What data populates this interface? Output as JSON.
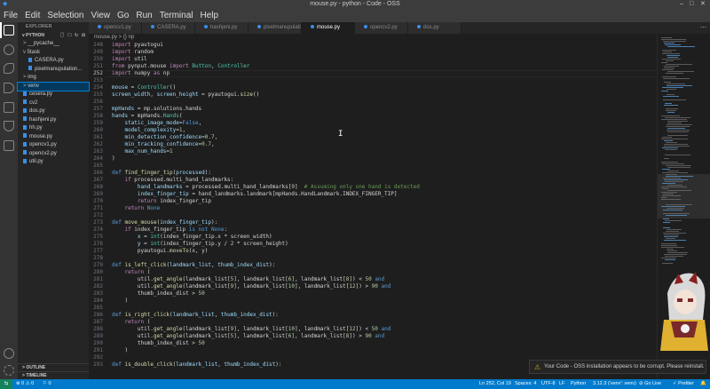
{
  "window": {
    "title": "mouse.py - python - Code - OSS",
    "controls": [
      "–",
      "□",
      "✕"
    ]
  },
  "menu": [
    "File",
    "Edit",
    "Selection",
    "View",
    "Go",
    "Run",
    "Terminal",
    "Help"
  ],
  "sidebar": {
    "title": "EXPLORER",
    "folder": "PYTHON",
    "items": [
      {
        "label": "__pycache__",
        "prefix": ">",
        "indent": 1
      },
      {
        "label": "5task",
        "prefix": "v",
        "indent": 1
      },
      {
        "label": "CASERA.py",
        "indent": 2
      },
      {
        "label": "pixelmanupulation...",
        "indent": 2
      },
      {
        "label": "img",
        "prefix": ">",
        "indent": 1
      },
      {
        "label": "venv",
        "prefix": ">",
        "indent": 1,
        "selected": true
      },
      {
        "label": "cesera.py",
        "indent": 1
      },
      {
        "label": "cv2",
        "indent": 1
      },
      {
        "label": "dos.py",
        "indent": 1
      },
      {
        "label": "hashjeni.py",
        "indent": 1
      },
      {
        "label": "hh.py",
        "indent": 1
      },
      {
        "label": "mouse.py",
        "indent": 1
      },
      {
        "label": "opencv1.py",
        "indent": 1
      },
      {
        "label": "opencv2.py",
        "indent": 1
      },
      {
        "label": "util.py",
        "indent": 1
      }
    ],
    "outline": "OUTLINE",
    "timeline": "TIMELINE"
  },
  "tabs": [
    {
      "label": "opencv1.py"
    },
    {
      "label": "CASERA.py"
    },
    {
      "label": "hashjeni.py"
    },
    {
      "label": "pixelmanupulation.py"
    },
    {
      "label": "mouse.py",
      "active": true
    },
    {
      "label": "opencv2.py"
    },
    {
      "label": "dos.py"
    }
  ],
  "breadcrumb": "mouse.py > {} np",
  "editor": {
    "current_line": 252,
    "lines": [
      {
        "n": 248,
        "html": "<span class=\"kw2\">import</span> pyautogui"
      },
      {
        "n": 249,
        "html": "<span class=\"kw2\">import</span> random"
      },
      {
        "n": 250,
        "html": "<span class=\"kw2\">import</span> util"
      },
      {
        "n": 251,
        "html": "<span class=\"kw2\">from</span> pynput.mouse <span class=\"kw2\">import</span> <span class=\"cls\">Button</span>, <span class=\"cls\">Controller</span>"
      },
      {
        "n": 252,
        "html": "<span class=\"kw2\">import</span> numpy <span class=\"kw2\">as</span> np"
      },
      {
        "n": 253,
        "html": ""
      },
      {
        "n": 254,
        "html": "<span class=\"vr\">mouse</span> = <span class=\"cls\">Controller</span>()"
      },
      {
        "n": 255,
        "html": "<span class=\"vr\">screen_width</span>, <span class=\"vr\">screen_height</span> = pyautogui.<span class=\"fn\">size</span>()"
      },
      {
        "n": 256,
        "html": ""
      },
      {
        "n": 257,
        "html": "<span class=\"vr\">mpHands</span> = mp.solutions.hands"
      },
      {
        "n": 258,
        "html": "<span class=\"vr\">hands</span> = mpHands.<span class=\"cls\">Hands</span>("
      },
      {
        "n": 259,
        "html": "    <span class=\"vr\">static_image_mode</span>=<span class=\"kw\">False</span>,"
      },
      {
        "n": 260,
        "html": "    <span class=\"vr\">model_complexity</span>=<span class=\"num\">1</span>,"
      },
      {
        "n": 261,
        "html": "    <span class=\"vr\">min_detection_confidence</span>=<span class=\"num\">0.7</span>,"
      },
      {
        "n": 262,
        "html": "    <span class=\"vr\">min_tracking_confidence</span>=<span class=\"num\">0.7</span>,"
      },
      {
        "n": 263,
        "html": "    <span class=\"vr\">max_num_hands</span>=<span class=\"num\">1</span>"
      },
      {
        "n": 264,
        "html": ")"
      },
      {
        "n": 265,
        "html": ""
      },
      {
        "n": 266,
        "html": "<span class=\"kw\">def</span> <span class=\"fn\">find_finger_tip</span>(<span class=\"vr\">processed</span>):"
      },
      {
        "n": 267,
        "html": "    <span class=\"kw2\">if</span> processed.multi_hand_landmarks:"
      },
      {
        "n": 268,
        "html": "        <span class=\"vr\">hand_landmarks</span> = processed.multi_hand_landmarks[<span class=\"num\">0</span>]  <span class=\"cm\"># Assuming only one hand is detected</span>"
      },
      {
        "n": 269,
        "html": "        <span class=\"vr\">index_finger_tip</span> = hand_landmarks.landmark[mpHands.HandLandmark.INDEX_FINGER_TIP]"
      },
      {
        "n": 270,
        "html": "        <span class=\"kw2\">return</span> index_finger_tip"
      },
      {
        "n": 271,
        "html": "    <span class=\"kw2\">return</span> <span class=\"kw\">None</span>"
      },
      {
        "n": 272,
        "html": ""
      },
      {
        "n": 273,
        "html": "<span class=\"kw\">def</span> <span class=\"fn\">move_mouse</span>(<span class=\"vr\">index_finger_tip</span>):"
      },
      {
        "n": 274,
        "html": "    <span class=\"kw2\">if</span> index_finger_tip <span class=\"kw\">is not</span> <span class=\"kw\">None</span>:"
      },
      {
        "n": 275,
        "html": "        <span class=\"vr\">x</span> = <span class=\"cls\">int</span>(index_finger_tip.x * screen_width)"
      },
      {
        "n": 276,
        "html": "        <span class=\"vr\">y</span> = <span class=\"cls\">int</span>(index_finger_tip.y / <span class=\"num\">2</span> * screen_height)"
      },
      {
        "n": 277,
        "html": "        pyautogui.<span class=\"fn\">moveTo</span>(x, y)"
      },
      {
        "n": 278,
        "html": ""
      },
      {
        "n": 279,
        "html": "<span class=\"kw\">def</span> <span class=\"fn\">is_left_click</span>(<span class=\"vr\">landmark_list</span>, <span class=\"vr\">thumb_index_dist</span>):"
      },
      {
        "n": 280,
        "html": "    <span class=\"kw2\">return</span> ("
      },
      {
        "n": 281,
        "html": "        util.<span class=\"fn\">get_angle</span>(landmark_list[<span class=\"num\">5</span>], landmark_list[<span class=\"num\">6</span>], landmark_list[<span class=\"num\">8</span>]) &lt; <span class=\"num\">50</span> <span class=\"kw\">and</span>"
      },
      {
        "n": 282,
        "html": "        util.<span class=\"fn\">get_angle</span>(landmark_list[<span class=\"num\">9</span>], landmark_list[<span class=\"num\">10</span>], landmark_list[<span class=\"num\">12</span>]) &gt; <span class=\"num\">90</span> <span class=\"kw\">and</span>"
      },
      {
        "n": 283,
        "html": "        thumb_index_dist &gt; <span class=\"num\">50</span>"
      },
      {
        "n": 284,
        "html": "    )"
      },
      {
        "n": 285,
        "html": ""
      },
      {
        "n": 286,
        "html": "<span class=\"kw\">def</span> <span class=\"fn\">is_right_click</span>(<span class=\"vr\">landmark_list</span>, <span class=\"vr\">thumb_index_dist</span>):"
      },
      {
        "n": 287,
        "html": "    <span class=\"kw2\">return</span> ("
      },
      {
        "n": 288,
        "html": "        util.<span class=\"fn\">get_angle</span>(landmark_list[<span class=\"num\">9</span>], landmark_list[<span class=\"num\">10</span>], landmark_list[<span class=\"num\">12</span>]) &lt; <span class=\"num\">50</span> <span class=\"kw\">and</span>"
      },
      {
        "n": 289,
        "html": "        util.<span class=\"fn\">get_angle</span>(landmark_list[<span class=\"num\">5</span>], landmark_list[<span class=\"num\">6</span>], landmark_list[<span class=\"num\">8</span>]) &gt; <span class=\"num\">90</span> <span class=\"kw\">and</span>"
      },
      {
        "n": 290,
        "html": "        thumb_index_dist &gt; <span class=\"num\">50</span>"
      },
      {
        "n": 291,
        "html": "    )"
      },
      {
        "n": 292,
        "html": ""
      },
      {
        "n": 293,
        "html": "<span class=\"kw\">def</span> <span class=\"fn\">is_double_click</span>(<span class=\"vr\">landmark_list</span>, <span class=\"vr\">thumb_index_dist</span>):"
      }
    ]
  },
  "notification": {
    "text": "Your Code - OSS installation appears to be corrupt. Please reinstall."
  },
  "status": {
    "left_errors": "⊗ 0 ⚠ 0",
    "left_ports": "⚐ 0",
    "position": "Ln 252, Col 19",
    "spaces": "Spaces: 4",
    "encoding": "UTF-8",
    "eol": "LF",
    "language": "Python",
    "interpreter": "3.12.3 ('venv': venv)",
    "golive": "⊘ Go Live",
    "prettier": "✓ Prettier",
    "bell": "🔔"
  },
  "colors": {
    "statusbar": "#007acc",
    "accent": "#007fd4",
    "background": "#1e1e1e",
    "warning": "#cca700"
  }
}
